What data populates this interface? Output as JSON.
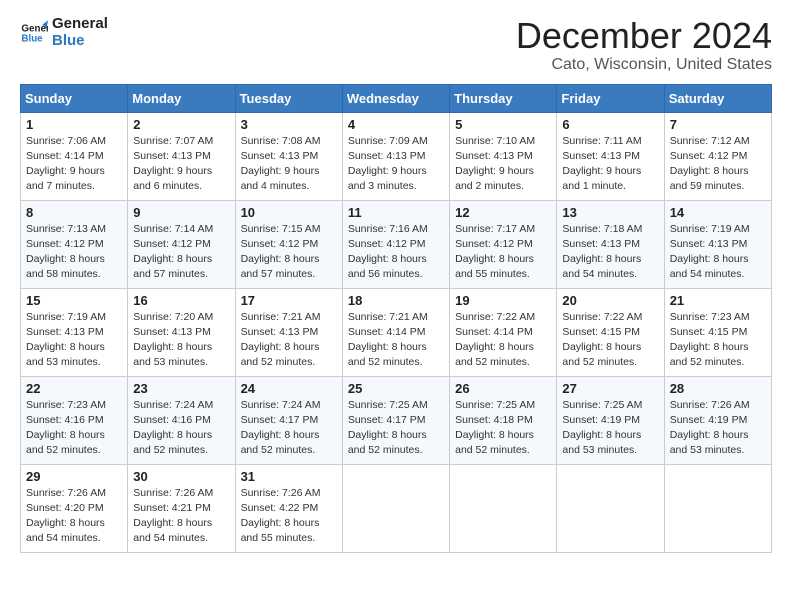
{
  "logo": {
    "line1": "General",
    "line2": "Blue"
  },
  "title": "December 2024",
  "subtitle": "Cato, Wisconsin, United States",
  "days_of_week": [
    "Sunday",
    "Monday",
    "Tuesday",
    "Wednesday",
    "Thursday",
    "Friday",
    "Saturday"
  ],
  "weeks": [
    [
      {
        "day": "1",
        "sunrise": "7:06 AM",
        "sunset": "4:14 PM",
        "daylight": "9 hours and 7 minutes."
      },
      {
        "day": "2",
        "sunrise": "7:07 AM",
        "sunset": "4:13 PM",
        "daylight": "9 hours and 6 minutes."
      },
      {
        "day": "3",
        "sunrise": "7:08 AM",
        "sunset": "4:13 PM",
        "daylight": "9 hours and 4 minutes."
      },
      {
        "day": "4",
        "sunrise": "7:09 AM",
        "sunset": "4:13 PM",
        "daylight": "9 hours and 3 minutes."
      },
      {
        "day": "5",
        "sunrise": "7:10 AM",
        "sunset": "4:13 PM",
        "daylight": "9 hours and 2 minutes."
      },
      {
        "day": "6",
        "sunrise": "7:11 AM",
        "sunset": "4:13 PM",
        "daylight": "9 hours and 1 minute."
      },
      {
        "day": "7",
        "sunrise": "7:12 AM",
        "sunset": "4:12 PM",
        "daylight": "8 hours and 59 minutes."
      }
    ],
    [
      {
        "day": "8",
        "sunrise": "7:13 AM",
        "sunset": "4:12 PM",
        "daylight": "8 hours and 58 minutes."
      },
      {
        "day": "9",
        "sunrise": "7:14 AM",
        "sunset": "4:12 PM",
        "daylight": "8 hours and 57 minutes."
      },
      {
        "day": "10",
        "sunrise": "7:15 AM",
        "sunset": "4:12 PM",
        "daylight": "8 hours and 57 minutes."
      },
      {
        "day": "11",
        "sunrise": "7:16 AM",
        "sunset": "4:12 PM",
        "daylight": "8 hours and 56 minutes."
      },
      {
        "day": "12",
        "sunrise": "7:17 AM",
        "sunset": "4:12 PM",
        "daylight": "8 hours and 55 minutes."
      },
      {
        "day": "13",
        "sunrise": "7:18 AM",
        "sunset": "4:13 PM",
        "daylight": "8 hours and 54 minutes."
      },
      {
        "day": "14",
        "sunrise": "7:19 AM",
        "sunset": "4:13 PM",
        "daylight": "8 hours and 54 minutes."
      }
    ],
    [
      {
        "day": "15",
        "sunrise": "7:19 AM",
        "sunset": "4:13 PM",
        "daylight": "8 hours and 53 minutes."
      },
      {
        "day": "16",
        "sunrise": "7:20 AM",
        "sunset": "4:13 PM",
        "daylight": "8 hours and 53 minutes."
      },
      {
        "day": "17",
        "sunrise": "7:21 AM",
        "sunset": "4:13 PM",
        "daylight": "8 hours and 52 minutes."
      },
      {
        "day": "18",
        "sunrise": "7:21 AM",
        "sunset": "4:14 PM",
        "daylight": "8 hours and 52 minutes."
      },
      {
        "day": "19",
        "sunrise": "7:22 AM",
        "sunset": "4:14 PM",
        "daylight": "8 hours and 52 minutes."
      },
      {
        "day": "20",
        "sunrise": "7:22 AM",
        "sunset": "4:15 PM",
        "daylight": "8 hours and 52 minutes."
      },
      {
        "day": "21",
        "sunrise": "7:23 AM",
        "sunset": "4:15 PM",
        "daylight": "8 hours and 52 minutes."
      }
    ],
    [
      {
        "day": "22",
        "sunrise": "7:23 AM",
        "sunset": "4:16 PM",
        "daylight": "8 hours and 52 minutes."
      },
      {
        "day": "23",
        "sunrise": "7:24 AM",
        "sunset": "4:16 PM",
        "daylight": "8 hours and 52 minutes."
      },
      {
        "day": "24",
        "sunrise": "7:24 AM",
        "sunset": "4:17 PM",
        "daylight": "8 hours and 52 minutes."
      },
      {
        "day": "25",
        "sunrise": "7:25 AM",
        "sunset": "4:17 PM",
        "daylight": "8 hours and 52 minutes."
      },
      {
        "day": "26",
        "sunrise": "7:25 AM",
        "sunset": "4:18 PM",
        "daylight": "8 hours and 52 minutes."
      },
      {
        "day": "27",
        "sunrise": "7:25 AM",
        "sunset": "4:19 PM",
        "daylight": "8 hours and 53 minutes."
      },
      {
        "day": "28",
        "sunrise": "7:26 AM",
        "sunset": "4:19 PM",
        "daylight": "8 hours and 53 minutes."
      }
    ],
    [
      {
        "day": "29",
        "sunrise": "7:26 AM",
        "sunset": "4:20 PM",
        "daylight": "8 hours and 54 minutes."
      },
      {
        "day": "30",
        "sunrise": "7:26 AM",
        "sunset": "4:21 PM",
        "daylight": "8 hours and 54 minutes."
      },
      {
        "day": "31",
        "sunrise": "7:26 AM",
        "sunset": "4:22 PM",
        "daylight": "8 hours and 55 minutes."
      },
      null,
      null,
      null,
      null
    ]
  ],
  "labels": {
    "sunrise": "Sunrise:",
    "sunset": "Sunset:",
    "daylight": "Daylight:"
  }
}
